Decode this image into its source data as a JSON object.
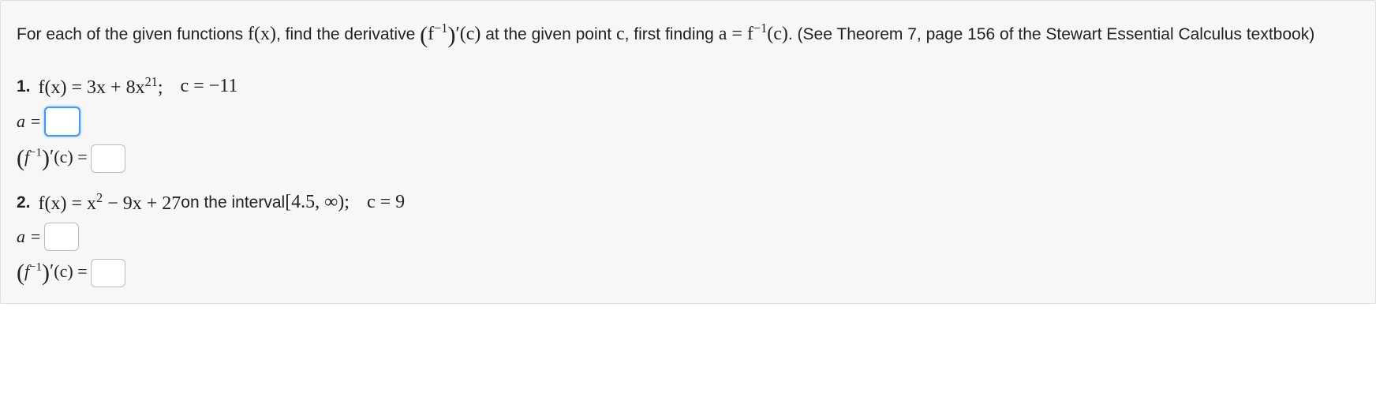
{
  "intro": {
    "part1": "For each of the given functions ",
    "fx": "f(x)",
    "part2": ", find the derivative ",
    "dinv_open": "(",
    "finv": "f",
    "neg1": "−1",
    "dinv_close": ")",
    "prime": "′",
    "c_arg": "(c)",
    "part3": " at the given point ",
    "c_var": "c",
    "part4": ", first finding ",
    "a_eq": "a = ",
    "finv2": "f",
    "neg1b": "−1",
    "c_arg2": "(c)",
    "part5": ". (See Theorem 7, page 156 of the Stewart Essential Calculus textbook)"
  },
  "problems": [
    {
      "num": "1.",
      "func": "f(x) = 3x + 8x",
      "exp": "21",
      "semicolon": ";",
      "c_label": "c = −11",
      "interval_text": ""
    },
    {
      "num": "2.",
      "func": "f(x) = x",
      "exp": "2",
      "tail": " − 9x + 27",
      "interval_text": " on the interval ",
      "interval": "[4.5, ∞)",
      "semicolon": ";",
      "c_label": "c = 9"
    }
  ],
  "labels": {
    "a_eq": "a =",
    "deriv_open": "(",
    "deriv_f": "f",
    "deriv_neg1": "−1",
    "deriv_close": ")",
    "deriv_prime": "′",
    "deriv_c": "(c) ="
  }
}
